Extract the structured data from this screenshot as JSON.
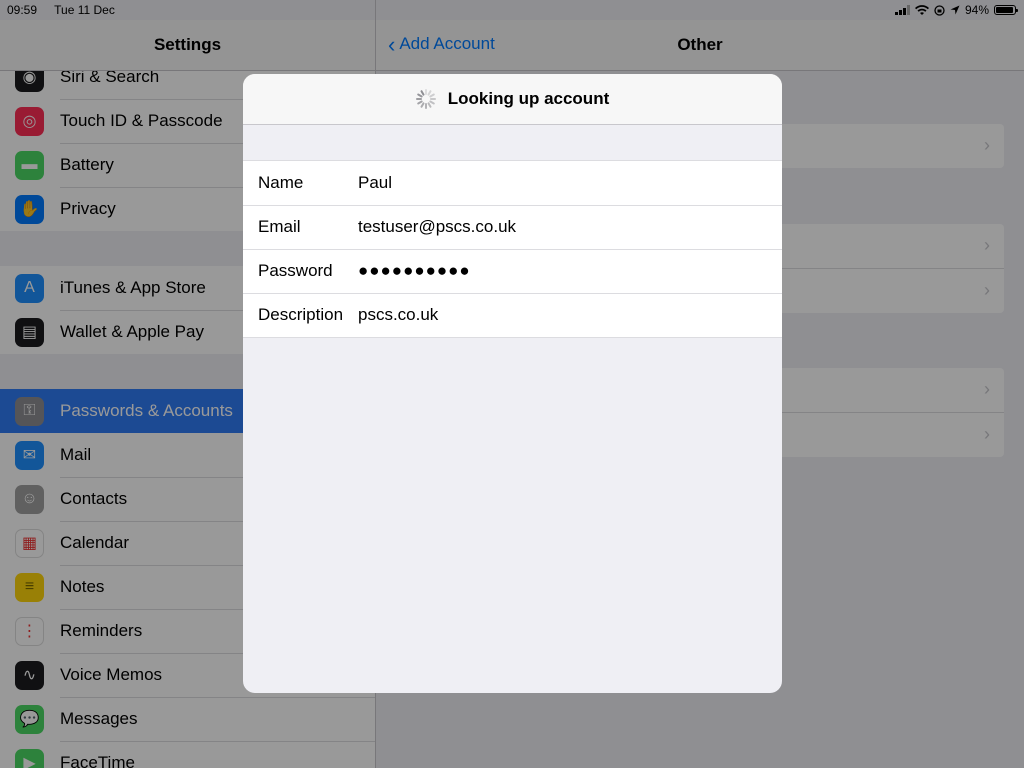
{
  "status_bar": {
    "time": "09:59",
    "date": "Tue 11 Dec",
    "battery": "94%",
    "battery_level": 0.94
  },
  "settings": {
    "title": "Settings",
    "groups": [
      [
        {
          "label": "Siri & Search",
          "icon": "siri-icon",
          "color": "#1c1c1e"
        },
        {
          "label": "Touch ID & Passcode",
          "icon": "fingerprint-icon",
          "color": "#ff2d55"
        },
        {
          "label": "Battery",
          "icon": "battery-icon",
          "color": "#4cd964"
        },
        {
          "label": "Privacy",
          "icon": "hand-icon",
          "color": "#007aff"
        }
      ],
      [
        {
          "label": "iTunes & App Store",
          "icon": "app-store-icon",
          "color": "#1e90ff"
        },
        {
          "label": "Wallet & Apple Pay",
          "icon": "wallet-icon",
          "color": "#1c1c1e"
        }
      ],
      [
        {
          "label": "Passwords & Accounts",
          "icon": "key-icon",
          "color": "#8e8e93",
          "selected": true
        },
        {
          "label": "Mail",
          "icon": "mail-icon",
          "color": "#1e90ff"
        },
        {
          "label": "Contacts",
          "icon": "contacts-icon",
          "color": "#a0a0a0"
        },
        {
          "label": "Calendar",
          "icon": "calendar-icon",
          "color": "#ffffff"
        },
        {
          "label": "Notes",
          "icon": "notes-icon",
          "color": "#ffd60a"
        },
        {
          "label": "Reminders",
          "icon": "reminders-icon",
          "color": "#ffffff"
        },
        {
          "label": "Voice Memos",
          "icon": "voice-memos-icon",
          "color": "#1c1c1e"
        },
        {
          "label": "Messages",
          "icon": "messages-icon",
          "color": "#4cd964"
        },
        {
          "label": "FaceTime",
          "icon": "facetime-icon",
          "color": "#4cd964"
        }
      ]
    ]
  },
  "detail": {
    "back_label": "Add Account",
    "title": "Other"
  },
  "modal": {
    "title": "Looking up account",
    "fields": [
      {
        "label": "Name",
        "value": "Paul"
      },
      {
        "label": "Email",
        "value": "testuser@pscs.co.uk"
      },
      {
        "label": "Password",
        "value": "●●●●●●●●●●"
      },
      {
        "label": "Description",
        "value": "pscs.co.uk"
      }
    ]
  }
}
